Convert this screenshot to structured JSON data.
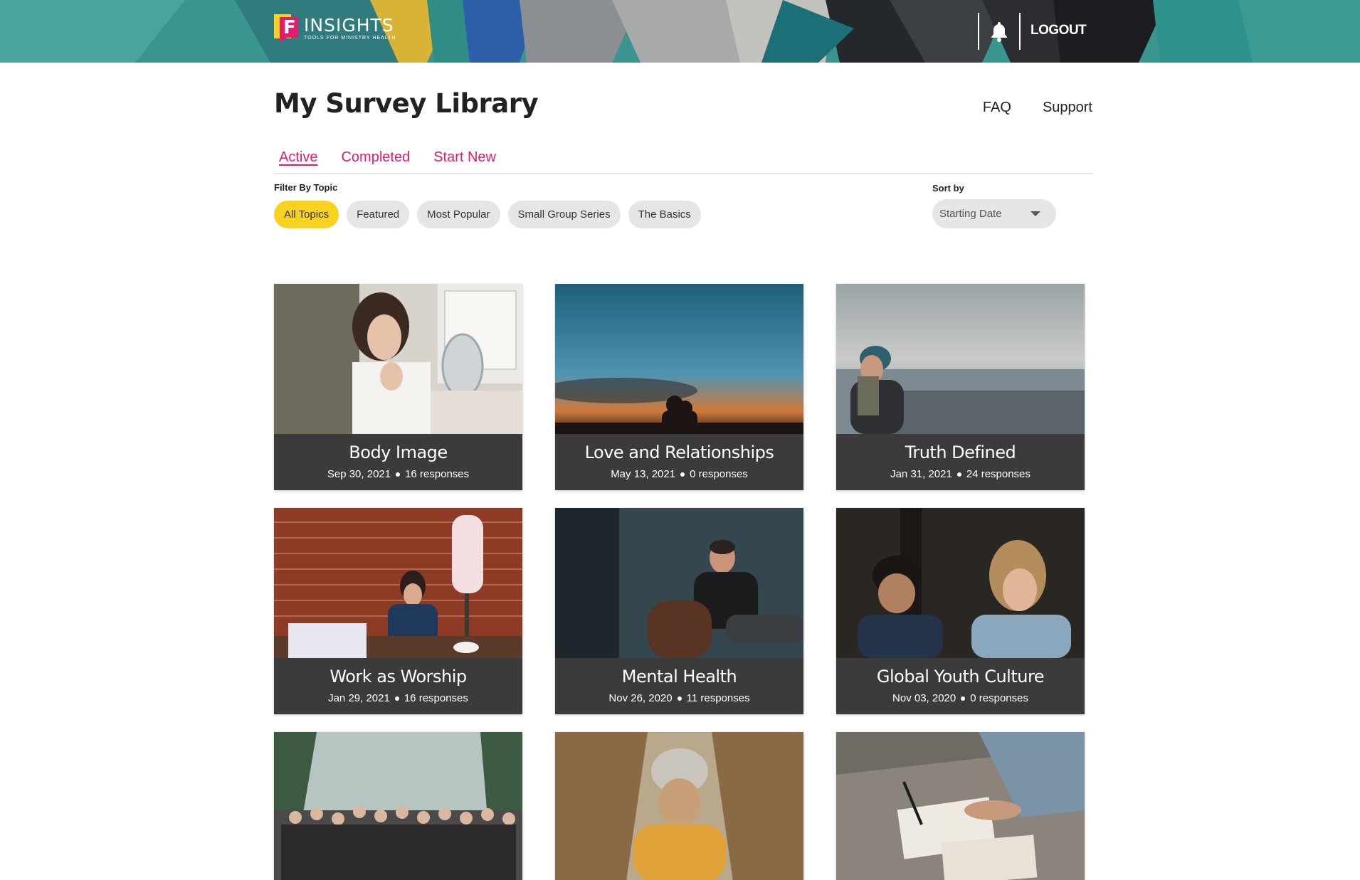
{
  "header": {
    "logo_title": "INSIGHTS",
    "logo_subtitle": "TOOLS FOR MINISTRY HEALTH",
    "logout_label": "LOGOUT",
    "bell_icon": "bell-icon"
  },
  "page": {
    "title": "My Survey Library",
    "links": {
      "faq": "FAQ",
      "support": "Support"
    }
  },
  "tabs": {
    "active": "Active",
    "completed": "Completed",
    "start_new": "Start New"
  },
  "filter": {
    "label": "Filter By Topic",
    "chips": [
      "All Topics",
      "Featured",
      "Most Popular",
      "Small Group Series",
      "The Basics"
    ]
  },
  "sort": {
    "label": "Sort by",
    "value": "Starting Date"
  },
  "surveys": [
    {
      "title": "Body Image",
      "date": "Sep 30, 2021",
      "responses": "16 responses"
    },
    {
      "title": "Love and Relationships",
      "date": "May 13, 2021",
      "responses": "0 responses"
    },
    {
      "title": "Truth Defined",
      "date": "Jan 31, 2021",
      "responses": "24 responses"
    },
    {
      "title": "Work as Worship",
      "date": "Jan 29, 2021",
      "responses": "16 responses"
    },
    {
      "title": "Mental Health",
      "date": "Nov 26, 2020",
      "responses": "11 responses"
    },
    {
      "title": "Global Youth Culture",
      "date": "Nov 03, 2020",
      "responses": "0 responses"
    }
  ],
  "colors": {
    "accent": "#e6196e",
    "chip_selected": "#f7d21e",
    "caption_bg": "#3d3a3b"
  }
}
